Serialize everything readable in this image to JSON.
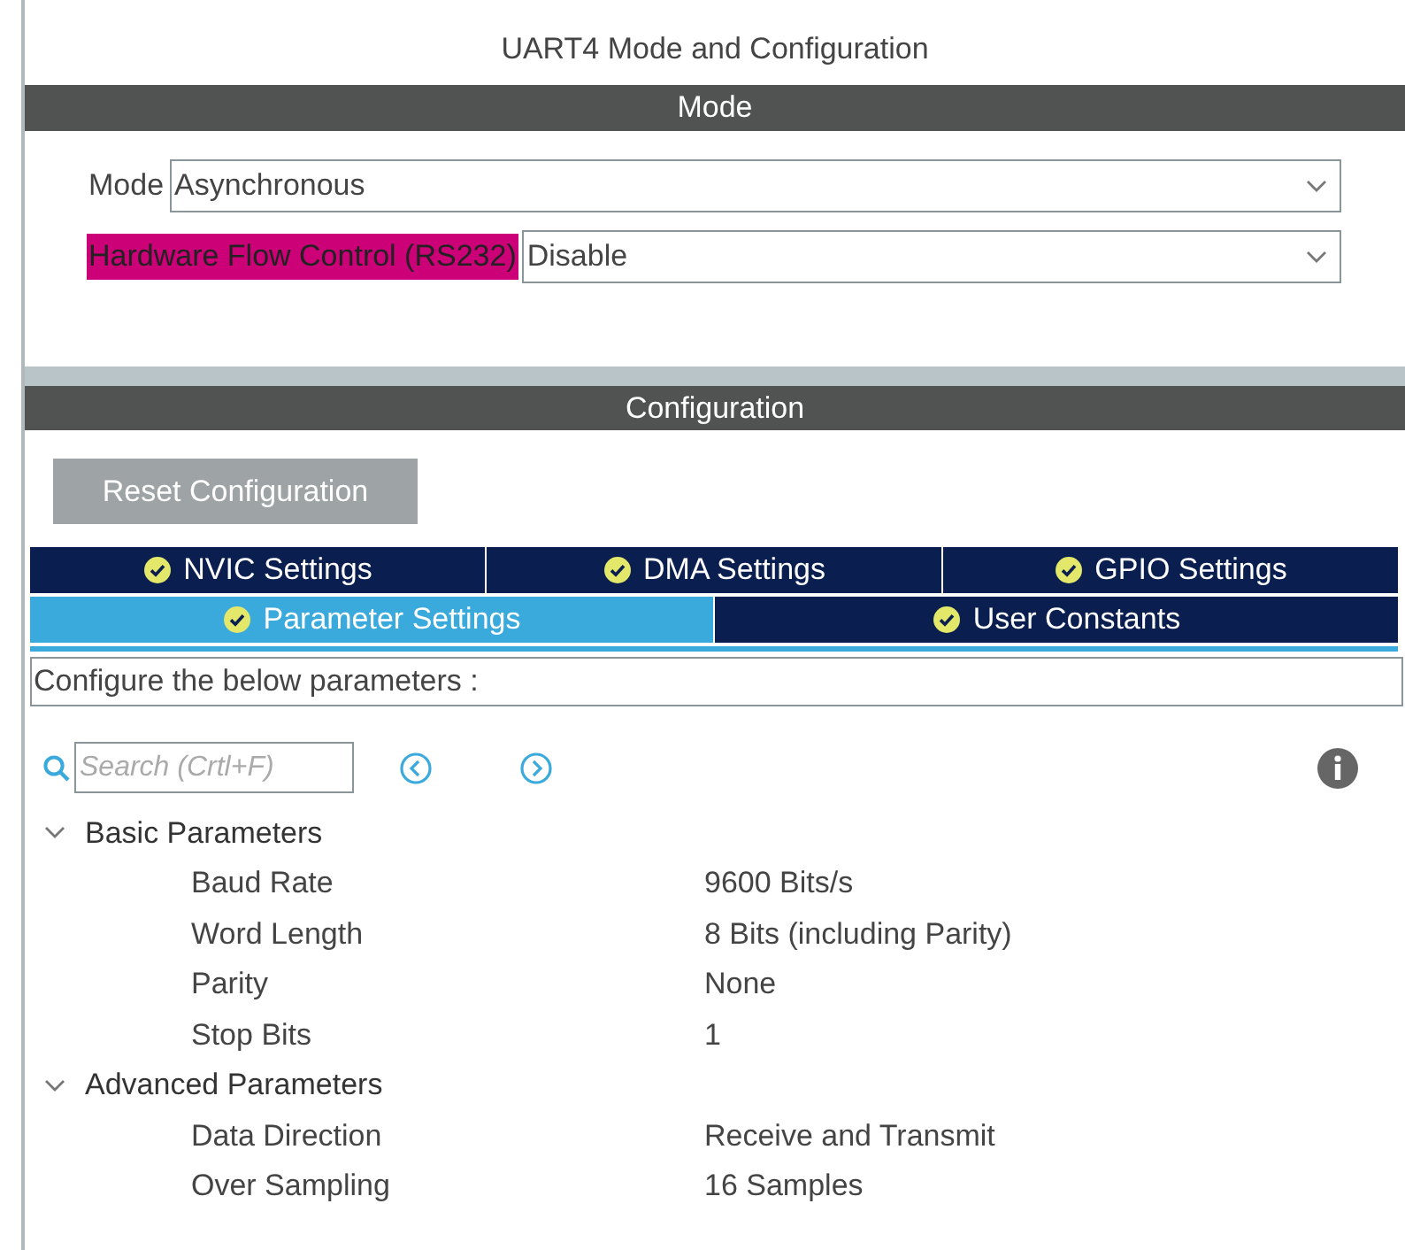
{
  "title": "UART4 Mode and Configuration",
  "mode_section": {
    "header": "Mode",
    "fields": [
      {
        "label": "Mode",
        "value": "Asynchronous",
        "highlighted": false
      },
      {
        "label": "Hardware Flow Control (RS232)",
        "value": "Disable",
        "highlighted": true
      }
    ]
  },
  "config_section": {
    "header": "Configuration",
    "reset_button": "Reset Configuration",
    "tab_rows": [
      [
        {
          "label": "NVIC Settings",
          "selected": false
        },
        {
          "label": "DMA Settings",
          "selected": false
        },
        {
          "label": "GPIO Settings",
          "selected": false
        }
      ],
      [
        {
          "label": "Parameter Settings",
          "selected": true
        },
        {
          "label": "User Constants",
          "selected": false
        }
      ]
    ],
    "description": "Configure the below parameters :",
    "search": {
      "placeholder": "Search (Crtl+F)"
    },
    "groups": [
      {
        "label": "Basic Parameters",
        "expanded": true,
        "params": [
          {
            "name": "Baud Rate",
            "value": "9600 Bits/s"
          },
          {
            "name": "Word Length",
            "value": "8 Bits (including Parity)"
          },
          {
            "name": "Parity",
            "value": "None"
          },
          {
            "name": "Stop Bits",
            "value": "1"
          }
        ]
      },
      {
        "label": "Advanced Parameters",
        "expanded": true,
        "params": [
          {
            "name": "Data Direction",
            "value": "Receive and Transmit"
          },
          {
            "name": "Over Sampling",
            "value": "16 Samples"
          }
        ]
      }
    ]
  }
}
